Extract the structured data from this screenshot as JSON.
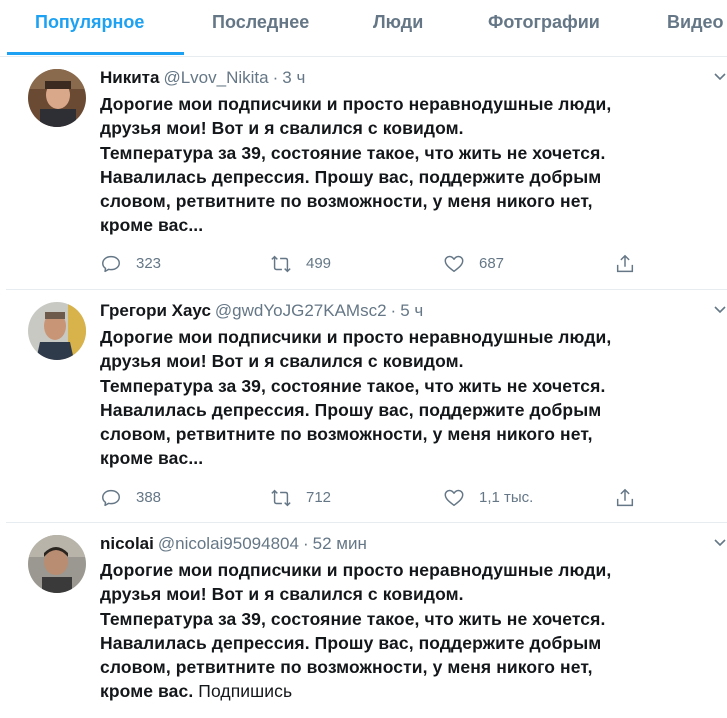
{
  "tabs": [
    {
      "label": "Популярное",
      "active": true
    },
    {
      "label": "Последнее",
      "active": false
    },
    {
      "label": "Люди",
      "active": false
    },
    {
      "label": "Фотографии",
      "active": false
    },
    {
      "label": "Видео",
      "active": false
    }
  ],
  "tweets": [
    {
      "name": "Никита",
      "handle": "@Lvov_Nikita",
      "dot": "·",
      "time": "3 ч",
      "lines": [
        "Дорогие  мои подписчики и просто неравнодушные люди,",
        "друзья мои!  Вот и я свалился с ковидом.",
        "Температура  за 39, состояние такое, что жить не хочется.",
        "Навалилась депрессия.  Прошу вас,  поддержите добрым",
        "словом,  ретвитните по возможности,  у меня никого  нет,",
        "кроме вас..."
      ],
      "extra": "",
      "replies": "323",
      "retweets": "499",
      "likes": "687"
    },
    {
      "name": "Грегори Хаус",
      "handle": "@gwdYoJG27KAMsc2",
      "dot": "·",
      "time": "5 ч",
      "lines": [
        "Дорогие  мои подписчики и просто неравнодушные люди,",
        "друзья мои!  Вот и я свалился с ковидом.",
        "Температура  за 39, состояние такое, что жить не хочется.",
        "Навалилась депрессия.  Прошу вас,  поддержите добрым",
        "словом,  ретвитните по возможности,  у меня никого  нет,",
        "кроме вас..."
      ],
      "extra": "",
      "replies": "388",
      "retweets": "712",
      "likes": "1,1 тыс."
    },
    {
      "name": "nicolai",
      "handle": "@nicolai95094804",
      "dot": "·",
      "time": "52 мин",
      "lines": [
        "Дорогие мои подписчики и просто неравнодушные люди,",
        "друзья мои! Вот и я свалился с ковидом.",
        "Температура  за 39, состояние такое, что жить не хочется.",
        "Навалилась депрессия. Прошу вас, поддержите добрым",
        "словом,  ретвитните по возможности, у меня никого  нет,",
        "кроме вас."
      ],
      "extra": " Подпишись",
      "replies": "",
      "retweets": "",
      "likes": ""
    }
  ],
  "colors": {
    "accent": "#1da1f2",
    "muted": "#657786",
    "text": "#14171a",
    "border": "#e6ecf0"
  },
  "icons": [
    "reply-icon",
    "retweet-icon",
    "like-icon",
    "share-icon",
    "chevron-down-icon"
  ]
}
